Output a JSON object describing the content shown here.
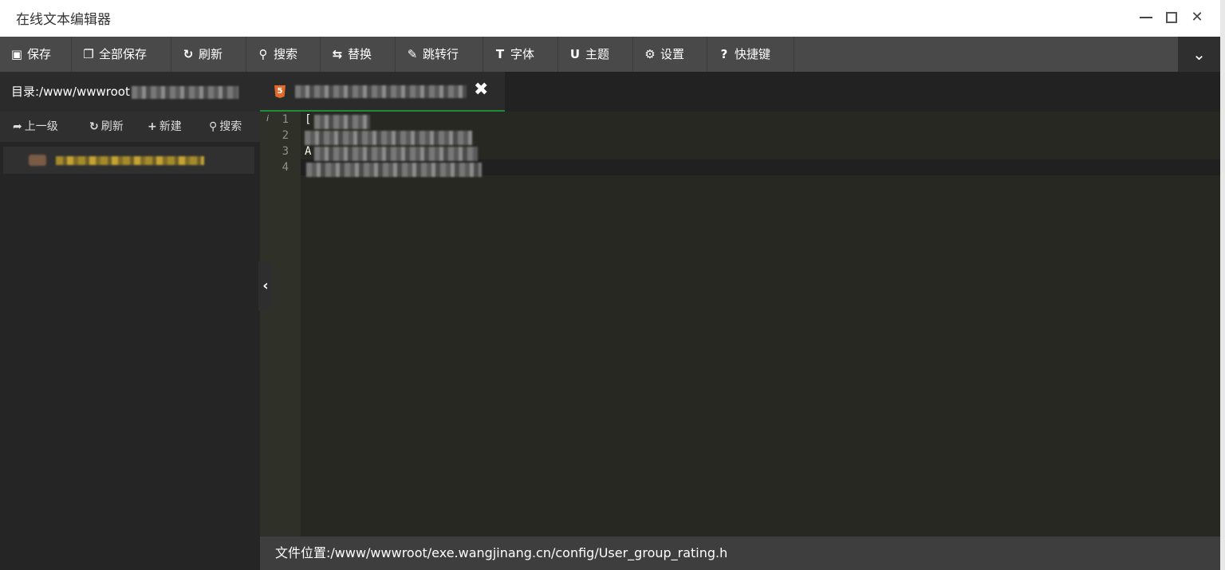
{
  "window": {
    "title": "在线文本编辑器",
    "controls": {
      "minimize_icon": "minimize-icon",
      "maximize_icon": "maximize-icon",
      "close_icon": "close-icon"
    }
  },
  "toolbar": {
    "buttons": [
      {
        "label": "保存",
        "icon": "save-icon",
        "glyph": "▣"
      },
      {
        "label": "全部保存",
        "icon": "save-all-icon",
        "glyph": "❐"
      },
      {
        "label": "刷新",
        "icon": "refresh-icon",
        "glyph": "↻"
      },
      {
        "label": "搜索",
        "icon": "search-icon",
        "glyph": "⚲"
      },
      {
        "label": "替换",
        "icon": "replace-icon",
        "glyph": "⇆"
      },
      {
        "label": "跳转行",
        "icon": "pin-icon",
        "glyph": "✎"
      },
      {
        "label": "字体",
        "icon": "font-icon",
        "glyph": "T"
      },
      {
        "label": "主题",
        "icon": "magnet-icon",
        "glyph": "U"
      },
      {
        "label": "设置",
        "icon": "gear-icon",
        "glyph": "⚙"
      },
      {
        "label": "快捷键",
        "icon": "question-icon",
        "glyph": "?"
      }
    ],
    "collapse_glyph": "⌄"
  },
  "sidebar": {
    "directory_label": "目录:/www/wwwroot",
    "actions": [
      {
        "label": "上一级",
        "glyph": "➦"
      },
      {
        "label": "刷新",
        "glyph": "↻"
      },
      {
        "label": "新建",
        "glyph": "+"
      },
      {
        "label": "搜索",
        "glyph": "⚲"
      }
    ]
  },
  "editor": {
    "tab_close_glyph": "✖",
    "tab_icon_glyph": "5",
    "line_numbers": [
      "1",
      "2",
      "3",
      "4"
    ],
    "visible_code": [
      "[",
      "",
      "A",
      ""
    ],
    "info_glyph": "i",
    "collapse_handle_glyph": "‹"
  },
  "statusbar": {
    "file_location": "文件位置:/www/wwwroot/exe.wangjinang.cn/config/User_group_rating.h"
  },
  "colors": {
    "toolbar_bg": "#494949",
    "sidebar_bg": "#252525",
    "editor_bg": "#272822",
    "tab_accent": "#1e8c3a",
    "html_icon": "#e06a2a"
  }
}
